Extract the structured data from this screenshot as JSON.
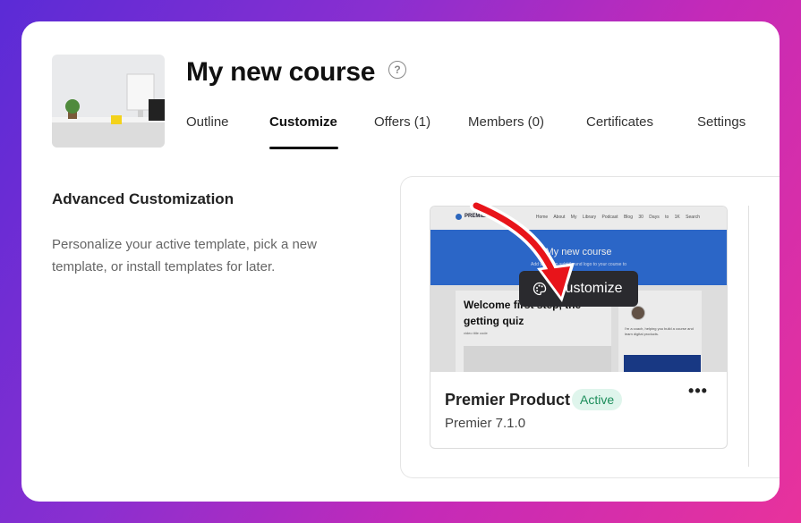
{
  "course": {
    "title": "My new course",
    "help_icon": "question-circle-icon"
  },
  "tabs": [
    {
      "label": "Outline"
    },
    {
      "label": "Customize",
      "active": true
    },
    {
      "label": "Offers (1)"
    },
    {
      "label": "Members (0)"
    },
    {
      "label": "Certificates"
    },
    {
      "label": "Settings"
    }
  ],
  "section": {
    "title": "Advanced Customization",
    "description": "Personalize your active template, pick a new template, or install templates for later."
  },
  "template": {
    "name": "Premier Product",
    "badge": "Active",
    "version": "Premier 7.1.0",
    "customize_label": "Customize",
    "customize_icon": "palette-icon",
    "more_label": "•••",
    "preview": {
      "logo": "PREMIER",
      "menu": "Home About My Library Podcast Blog 30 Days to 1K Search",
      "hero_title": "My new course",
      "hero_sub": "Add your own subtitle and logo to your course to",
      "welcome": "Welcome first step, the getting quiz",
      "small": "video title code",
      "side_text": "I'm a coach, helping you build a course and learn digital products."
    }
  },
  "colors": {
    "accent": "#111111",
    "badge_bg": "#dff5ec",
    "badge_text": "#1b8d5a",
    "arrow": "#e8141a",
    "hero": "#2f6fd8"
  }
}
